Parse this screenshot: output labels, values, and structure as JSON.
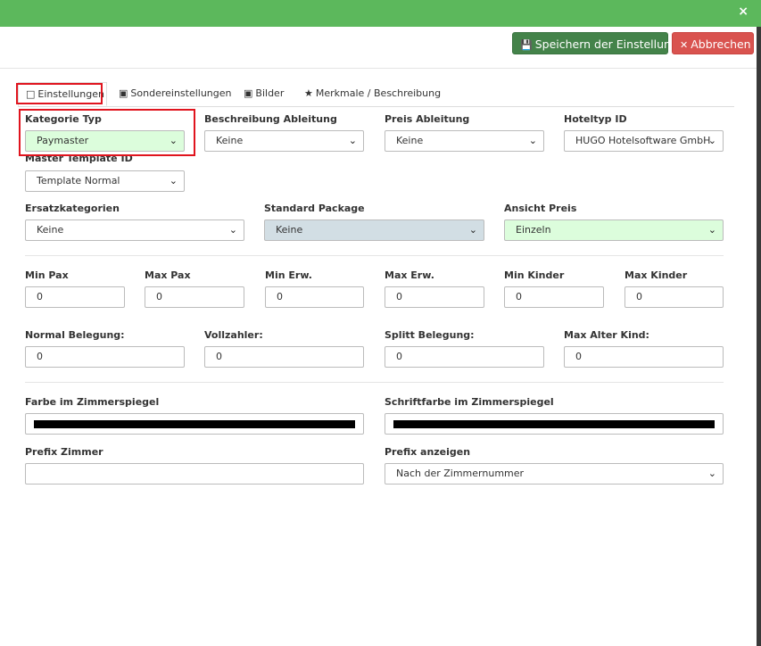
{
  "header": {
    "save_label": "Speichern der Einstellung",
    "cancel_label": "Abbrechen",
    "close_label": "×"
  },
  "tabs": [
    {
      "label": "Einstellungen",
      "icon": "crop-icon"
    },
    {
      "label": "Sondereinstellungen",
      "icon": "image-icon"
    },
    {
      "label": "Bilder",
      "icon": "image-icon"
    },
    {
      "label": "Merkmale / Beschreibung",
      "icon": "star-icon"
    }
  ],
  "fields": {
    "kategorie_typ": {
      "label": "Kategorie Typ",
      "value": "Paymaster"
    },
    "beschreibung_ableitung": {
      "label": "Beschreibung Ableitung",
      "value": "Keine"
    },
    "preis_ableitung": {
      "label": "Preis Ableitung",
      "value": "Keine"
    },
    "hoteltyp_id": {
      "label": "Hoteltyp ID",
      "value": "HUGO Hotelsoftware GmbH"
    },
    "master_template_id": {
      "label": "Master Template ID",
      "value": "Template Normal"
    },
    "ersatzkategorien": {
      "label": "Ersatzkategorien",
      "value": "Keine"
    },
    "standard_package": {
      "label": "Standard Package",
      "value": "Keine"
    },
    "ansicht_preis": {
      "label": "Ansicht Preis",
      "value": "Einzeln"
    },
    "min_pax": {
      "label": "Min Pax",
      "value": "0"
    },
    "max_pax": {
      "label": "Max Pax",
      "value": "0"
    },
    "min_erw": {
      "label": "Min Erw.",
      "value": "0"
    },
    "max_erw": {
      "label": "Max Erw.",
      "value": "0"
    },
    "min_kinder": {
      "label": "Min Kinder",
      "value": "0"
    },
    "max_kinder": {
      "label": "Max Kinder",
      "value": "0"
    },
    "normal_belegung": {
      "label": "Normal Belegung:",
      "value": "0"
    },
    "vollzahler": {
      "label": "Vollzahler:",
      "value": "0"
    },
    "splitt_belegung": {
      "label": "Splitt Belegung:",
      "value": "0"
    },
    "max_alter_kind": {
      "label": "Max Alter Kind:",
      "value": "0"
    },
    "farbe_zimmerspiegel": {
      "label": "Farbe im Zimmerspiegel",
      "color": "#000000"
    },
    "schriftfarbe_zimmerspiegel": {
      "label": "Schriftfarbe im Zimmerspiegel",
      "color": "#000000"
    },
    "prefix_zimmer": {
      "label": "Prefix Zimmer",
      "value": ""
    },
    "prefix_anzeigen": {
      "label": "Prefix anzeigen",
      "value": "Nach der Zimmernummer"
    }
  },
  "colors": {
    "success": "#5cb85c",
    "save_button": "#44834a",
    "danger": "#d9534f",
    "highlight": "#e0141e",
    "select_green": "#dcfddc",
    "select_disabled": "#d2dee4"
  }
}
